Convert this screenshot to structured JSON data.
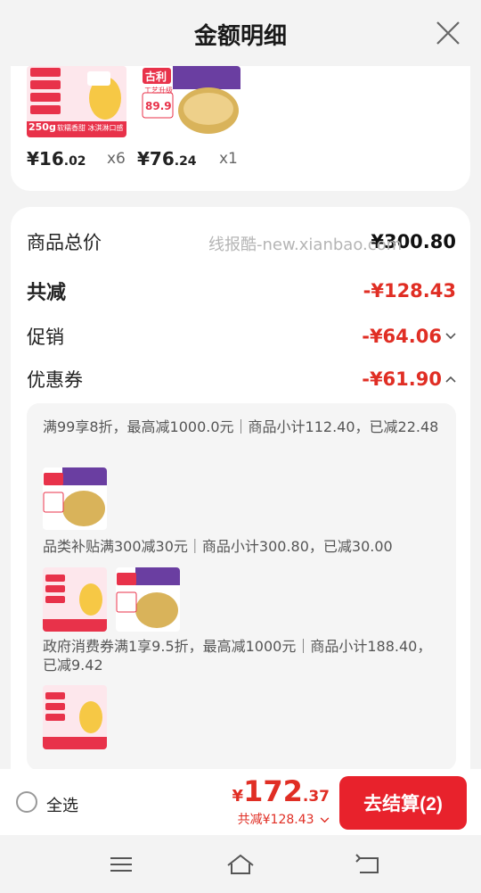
{
  "header": {
    "title": "金额明细"
  },
  "summary_products": [
    {
      "price_int": "¥16",
      "price_dec": ".02",
      "qty": "x6"
    },
    {
      "price_int": "¥76",
      "price_dec": ".24",
      "qty": "x1"
    }
  ],
  "product_image_text": {
    "a_weight": "250g",
    "a_slogan": "软糯香甜 冰淇淋口感",
    "b_brand": "古利",
    "b_tag": "工艺升级",
    "b_price": "89.9"
  },
  "watermark": "线报酷-new.xianbao.com",
  "breakdown": {
    "total_label": "商品总价",
    "total_value": "¥300.80",
    "reduce_label": "共减",
    "reduce_value": "-¥128.43",
    "promo_label": "促销",
    "promo_value": "-¥64.06",
    "coupon_label": "优惠券",
    "coupon_value": "-¥61.90"
  },
  "coupons": [
    {
      "text": "满99享8折，最高减1000.0元｜商品小计112.40，已减22.48"
    },
    {
      "text": "品类补贴满300减30元｜商品小计300.80，已减30.00"
    },
    {
      "text": "政府消费券满1享9.5折，最高减1000元｜商品小计188.40，已减9.42"
    }
  ],
  "bottom": {
    "select_all": "全选",
    "currency": "¥",
    "total_int": "172",
    "total_dec": ".37",
    "saved": "共减¥128.43",
    "checkout": "去结算(2)"
  },
  "colors": {
    "accent": "#e02e24",
    "button": "#e8222c"
  }
}
